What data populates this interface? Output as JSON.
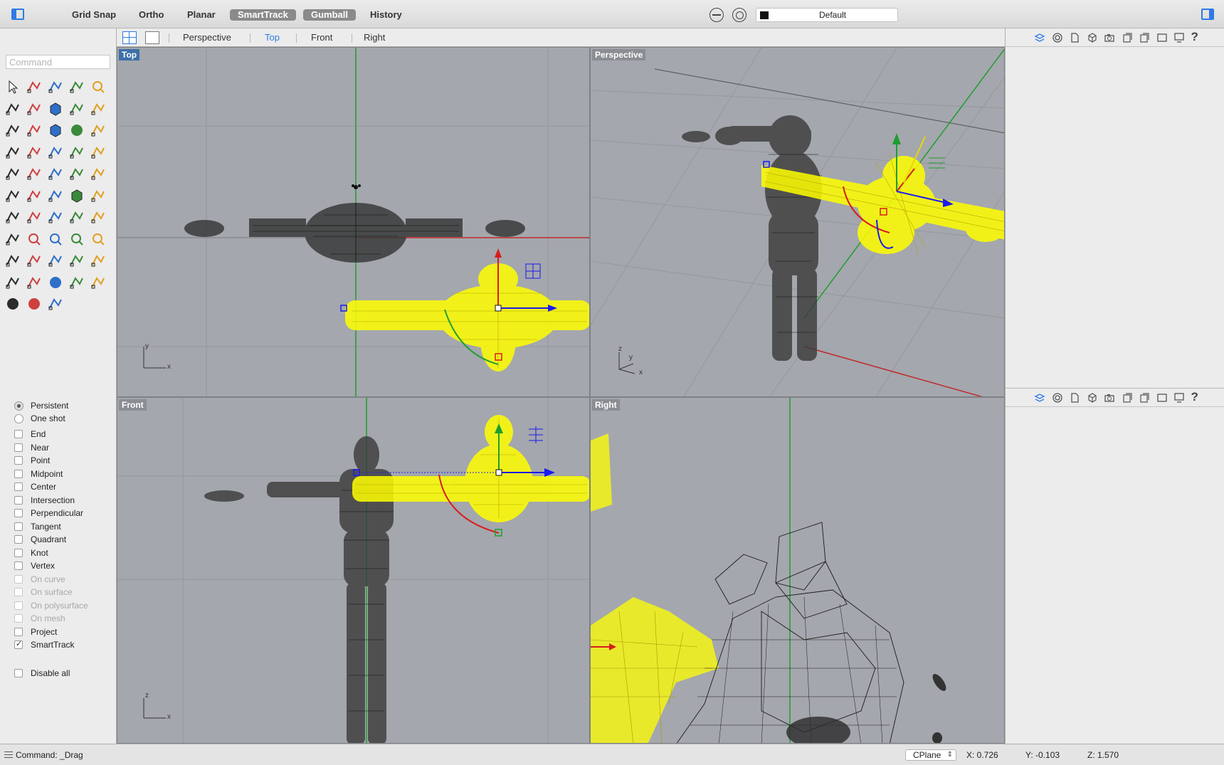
{
  "toolbar": {
    "modes": [
      {
        "label": "Grid Snap",
        "active": false
      },
      {
        "label": "Ortho",
        "active": false
      },
      {
        "label": "Planar",
        "active": false
      },
      {
        "label": "SmartTrack",
        "active": true
      },
      {
        "label": "Gumball",
        "active": true
      },
      {
        "label": "History",
        "active": false
      }
    ],
    "layer": {
      "name": "Default",
      "swatch_color": "#111111"
    }
  },
  "command": {
    "placeholder": "Command"
  },
  "viewport_tabs": [
    "Perspective",
    "Top",
    "Front",
    "Right"
  ],
  "viewport_tabs_active": "Top",
  "viewports": {
    "top": {
      "label": "Top",
      "axis_a": "y",
      "axis_b": "x",
      "active": true
    },
    "perspective": {
      "label": "Perspective",
      "axis_a": "z",
      "axis_b": "y",
      "axis_c": "x"
    },
    "front": {
      "label": "Front",
      "axis_a": "z",
      "axis_b": "x"
    },
    "right": {
      "label": "Right"
    }
  },
  "osnap": {
    "modes": [
      {
        "label": "Persistent",
        "checked": true
      },
      {
        "label": "One shot",
        "checked": false
      }
    ],
    "items": [
      {
        "label": "End",
        "checked": false,
        "enabled": true
      },
      {
        "label": "Near",
        "checked": false,
        "enabled": true
      },
      {
        "label": "Point",
        "checked": false,
        "enabled": true
      },
      {
        "label": "Midpoint",
        "checked": false,
        "enabled": true
      },
      {
        "label": "Center",
        "checked": false,
        "enabled": true
      },
      {
        "label": "Intersection",
        "checked": false,
        "enabled": true
      },
      {
        "label": "Perpendicular",
        "checked": false,
        "enabled": true
      },
      {
        "label": "Tangent",
        "checked": false,
        "enabled": true
      },
      {
        "label": "Quadrant",
        "checked": false,
        "enabled": true
      },
      {
        "label": "Knot",
        "checked": false,
        "enabled": true
      },
      {
        "label": "Vertex",
        "checked": false,
        "enabled": true
      },
      {
        "label": "On curve",
        "checked": false,
        "enabled": false
      },
      {
        "label": "On surface",
        "checked": false,
        "enabled": false
      },
      {
        "label": "On polysurface",
        "checked": false,
        "enabled": false
      },
      {
        "label": "On mesh",
        "checked": false,
        "enabled": false
      },
      {
        "label": "Project",
        "checked": false,
        "enabled": true
      },
      {
        "label": "SmartTrack",
        "checked": true,
        "enabled": true
      }
    ],
    "disable_all": "Disable all"
  },
  "right_panel": {
    "icons": [
      "layers-icon",
      "materials-icon",
      "properties-icon",
      "objects-icon",
      "render-icon",
      "texture-icon",
      "document-icon",
      "display-icon",
      "named-views-icon",
      "help-icon"
    ],
    "help_label": "?"
  },
  "status": {
    "command_text": "Command: _Drag",
    "cplane": "CPlane",
    "x": "X: 0.726",
    "y": "Y: -0.103",
    "z": "Z: 1.570"
  },
  "colors": {
    "accent": "#2f7ae5",
    "viewport_bg": "#a4a7ad",
    "selection": "#ffff00",
    "x_axis": "#c0282a",
    "y_axis": "#1e9e2e",
    "gumball_z": "#1a1aee"
  }
}
